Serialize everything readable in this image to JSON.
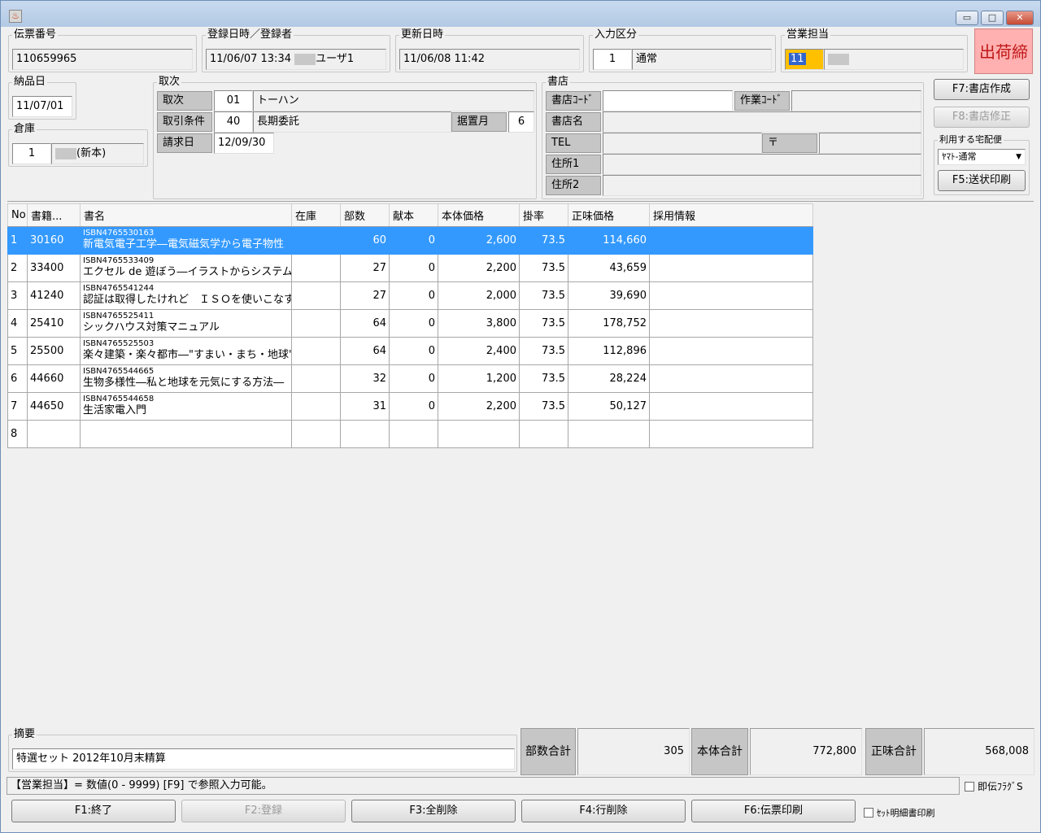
{
  "window": {
    "minimize": "▭",
    "maximize": "□",
    "close": "✕"
  },
  "header": {
    "slip_no": {
      "label": "伝票番号",
      "value": "110659965"
    },
    "registered": {
      "label": "登録日時／登録者",
      "value": "11/06/07 13:34",
      "user": "ユーザ1"
    },
    "updated": {
      "label": "更新日時",
      "value": "11/06/08 11:42"
    },
    "input_type": {
      "label": "入力区分",
      "code": "1",
      "name": "通常"
    },
    "sales_rep": {
      "label": "営業担当",
      "code": "11"
    },
    "ship_badge": "出荷締"
  },
  "delivery": {
    "label": "納品日",
    "value": "11/07/01"
  },
  "warehouse": {
    "label": "倉庫",
    "code": "1",
    "name": "(新本)"
  },
  "torij": {
    "legend": "取次",
    "distributor": {
      "label": "取次",
      "code": "01",
      "name": "トーハン"
    },
    "terms": {
      "label": "取引条件",
      "code": "40",
      "name": "長期委託",
      "sueoki_label": "据置月",
      "sueoki_value": "6"
    },
    "billing": {
      "label": "請求日",
      "value": "12/09/30"
    }
  },
  "store": {
    "legend": "書店",
    "code_label": "書店ｺｰﾄﾞ",
    "code_value": "",
    "work_label": "作業ｺｰﾄﾞ",
    "work_value": "",
    "name_label": "書店名",
    "name_value": "",
    "tel_label": "TEL",
    "tel_value": "",
    "zip_label": "〒",
    "zip_value": "",
    "addr1_label": "住所1",
    "addr1_value": "",
    "addr2_label": "住所2",
    "addr2_value": ""
  },
  "side": {
    "f7": "F7:書店作成",
    "f8": "F8:書店修正",
    "courier_legend": "利用する宅配便",
    "courier_value": "ﾔﾏﾄ-通常",
    "f5": "F5:送状印刷"
  },
  "grid": {
    "columns": [
      "No",
      "書籍...",
      "書名",
      "在庫",
      "部数",
      "献本",
      "本体価格",
      "掛率",
      "正味価格",
      "採用情報"
    ],
    "rows": [
      {
        "no": "1",
        "code": "30160",
        "isbn": "ISBN4765530163",
        "title": "新電気電子工学―電気磁気学から電子物性",
        "stock": "",
        "qty": "60",
        "gift": "0",
        "price": "2,600",
        "rate": "73.5",
        "net": "114,660",
        "info": ""
      },
      {
        "no": "2",
        "code": "33400",
        "isbn": "ISBN4765533409",
        "title": "エクセル de 遊ぼう―イラストからシステム",
        "stock": "",
        "qty": "27",
        "gift": "0",
        "price": "2,200",
        "rate": "73.5",
        "net": "43,659",
        "info": ""
      },
      {
        "no": "3",
        "code": "41240",
        "isbn": "ISBN4765541244",
        "title": "認証は取得したけれど　ＩＳＯを使いこなす",
        "stock": "",
        "qty": "27",
        "gift": "0",
        "price": "2,000",
        "rate": "73.5",
        "net": "39,690",
        "info": ""
      },
      {
        "no": "4",
        "code": "25410",
        "isbn": "ISBN4765525411",
        "title": "シックハウス対策マニュアル",
        "stock": "",
        "qty": "64",
        "gift": "0",
        "price": "3,800",
        "rate": "73.5",
        "net": "178,752",
        "info": ""
      },
      {
        "no": "5",
        "code": "25500",
        "isbn": "ISBN4765525503",
        "title": "楽々建築・楽々都市―\"すまい・まち・地球\"",
        "stock": "",
        "qty": "64",
        "gift": "0",
        "price": "2,400",
        "rate": "73.5",
        "net": "112,896",
        "info": ""
      },
      {
        "no": "6",
        "code": "44660",
        "isbn": "ISBN4765544665",
        "title": "生物多様性―私と地球を元気にする方法―",
        "stock": "",
        "qty": "32",
        "gift": "0",
        "price": "1,200",
        "rate": "73.5",
        "net": "28,224",
        "info": ""
      },
      {
        "no": "7",
        "code": "44650",
        "isbn": "ISBN4765544658",
        "title": "生活家電入門",
        "stock": "",
        "qty": "31",
        "gift": "0",
        "price": "2,200",
        "rate": "73.5",
        "net": "50,127",
        "info": ""
      },
      {
        "no": "8",
        "code": "",
        "isbn": "",
        "title": "",
        "stock": "",
        "qty": "",
        "gift": "",
        "price": "",
        "rate": "",
        "net": "",
        "info": ""
      }
    ]
  },
  "summary": {
    "memo_label": "摘要",
    "memo_value": "特選セット 2012年10月末精算",
    "qty_label": "部数合計",
    "qty_value": "305",
    "price_label": "本体合計",
    "price_value": "772,800",
    "net_label": "正味合計",
    "net_value": "568,008"
  },
  "status": {
    "message": "【営業担当】= 数値(0 - 9999) [F9] で参照入力可能。",
    "flag_label": "即伝ﾌﾗｸﾞS"
  },
  "footer": {
    "f1": "F1:終了",
    "f2": "F2:登録",
    "f3": "F3:全削除",
    "f4": "F4:行削除",
    "f6": "F6:伝票印刷",
    "set_print": "ｾｯﾄ明細書印刷"
  },
  "colors": {
    "selected_row": "#3399ff",
    "ship_badge_bg": "#ffb0b0",
    "sales_rep_highlight": "#ffc000"
  }
}
